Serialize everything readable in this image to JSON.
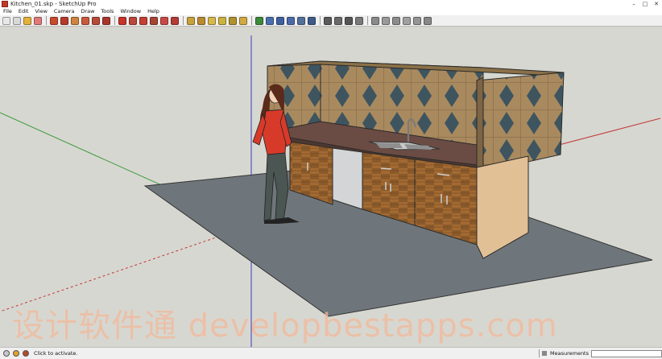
{
  "window": {
    "title": "Kitchen_01.skp - SketchUp Pro"
  },
  "title_controls": [
    "–",
    "□",
    "✕"
  ],
  "menu": [
    "File",
    "Edit",
    "View",
    "Camera",
    "Draw",
    "Tools",
    "Window",
    "Help"
  ],
  "toolbar": {
    "groups": [
      [
        {
          "name": "select-tool-icon",
          "color": "#e8e8e8"
        },
        {
          "name": "make-component-icon",
          "color": "#d9d9d9"
        },
        {
          "name": "paint-bucket-icon",
          "color": "#e4b23a"
        },
        {
          "name": "eraser-icon",
          "color": "#e07a7a"
        }
      ],
      [
        {
          "name": "rectangle-icon",
          "color": "#c94b2e"
        },
        {
          "name": "line-icon",
          "color": "#b53a2a"
        },
        {
          "name": "circle-icon",
          "color": "#d0833d"
        },
        {
          "name": "arc-icon",
          "color": "#c85a3a"
        },
        {
          "name": "polygon-icon",
          "color": "#b84a38"
        },
        {
          "name": "freehand-icon",
          "color": "#a8362c"
        }
      ],
      [
        {
          "name": "move-icon",
          "color": "#c8332a"
        },
        {
          "name": "push-pull-icon",
          "color": "#b9473a"
        },
        {
          "name": "rotate-icon",
          "color": "#c53f33"
        },
        {
          "name": "follow-me-icon",
          "color": "#a74534"
        },
        {
          "name": "scale-icon",
          "color": "#c94a45"
        },
        {
          "name": "offset-icon",
          "color": "#b33d36"
        }
      ],
      [
        {
          "name": "tape-measure-icon",
          "color": "#c8a13a"
        },
        {
          "name": "dimension-icon",
          "color": "#b98a2f"
        },
        {
          "name": "protractor-icon",
          "color": "#d7b84a"
        },
        {
          "name": "text-icon",
          "color": "#c9b33e"
        },
        {
          "name": "axes-icon",
          "color": "#b0922e"
        },
        {
          "name": "3d-text-icon",
          "color": "#d1aa44"
        }
      ],
      [
        {
          "name": "orbit-icon",
          "color": "#3c8a3c"
        },
        {
          "name": "pan-icon",
          "color": "#4a6fb0"
        },
        {
          "name": "zoom-icon",
          "color": "#3f5f9f"
        },
        {
          "name": "zoom-window-icon",
          "color": "#4b6aaa"
        },
        {
          "name": "zoom-extents-icon",
          "color": "#52709a"
        },
        {
          "name": "previous-view-icon",
          "color": "#3d5b88"
        }
      ],
      [
        {
          "name": "position-camera-icon",
          "color": "#5a5a5a"
        },
        {
          "name": "look-around-icon",
          "color": "#6a6a6a"
        },
        {
          "name": "walk-icon",
          "color": "#555555"
        },
        {
          "name": "section-plane-icon",
          "color": "#7a7a7a"
        }
      ],
      [
        {
          "name": "iso-view-icon",
          "color": "#8a8a8a"
        },
        {
          "name": "top-view-icon",
          "color": "#9a9a9a"
        },
        {
          "name": "front-view-icon",
          "color": "#8c8c8c"
        },
        {
          "name": "right-view-icon",
          "color": "#a0a0a0"
        },
        {
          "name": "back-view-icon",
          "color": "#949494"
        },
        {
          "name": "left-view-icon",
          "color": "#888888"
        }
      ]
    ]
  },
  "colors": {
    "ground": "#6f767b",
    "backsplash": "#a98a5f",
    "diamond": "#3e5560",
    "cabinet": "#8a5a2a",
    "cabinet_light": "#a36a32",
    "countertop": "#6a4c44",
    "end_panel": "#e2c095",
    "dishwasher": "#d3d5d6",
    "axis_red": "#c23a3a",
    "axis_green": "#3a9a3a",
    "axis_blue": "#3a3ac2"
  },
  "watermark": "设计软件通 developbestapps.com",
  "status": {
    "text": "Click to activate.",
    "measurements_label": "Measurements",
    "measurements_value": ""
  }
}
